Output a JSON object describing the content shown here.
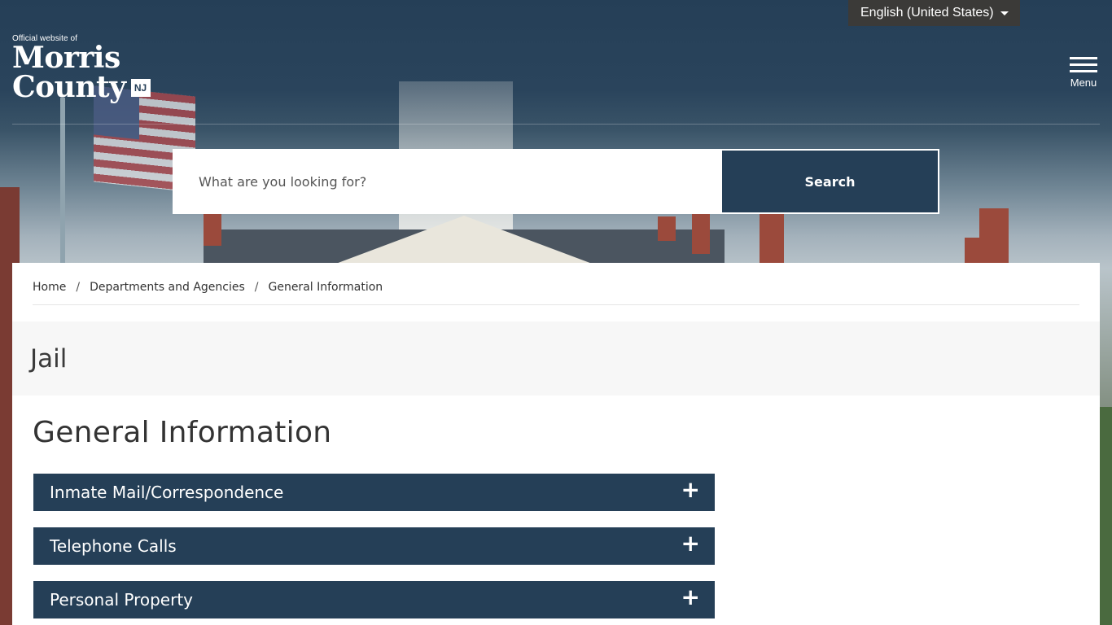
{
  "language_selector": {
    "label": "English (United States)"
  },
  "logo": {
    "tagline": "Official website of",
    "line1": "Morris",
    "line2": "County",
    "badge": "NJ"
  },
  "menu": {
    "label": "Menu"
  },
  "search": {
    "placeholder": "What are you looking for?",
    "button_label": "Search"
  },
  "breadcrumb": {
    "items": [
      "Home",
      "Departments and Agencies",
      "General Information"
    ],
    "separator": "/"
  },
  "page_title": "Jail",
  "section_heading": "General Information",
  "accordion": {
    "items": [
      {
        "label": "Inmate Mail/Correspondence",
        "icon": "plus-icon"
      },
      {
        "label": "Telephone Calls",
        "icon": "plus-icon"
      },
      {
        "label": "Personal Property",
        "icon": "plus-icon"
      }
    ],
    "expand_symbol": "+"
  },
  "colors": {
    "primary": "#253f57",
    "title_band": "#f7f7f7",
    "language_bg": "#3b3a38"
  }
}
